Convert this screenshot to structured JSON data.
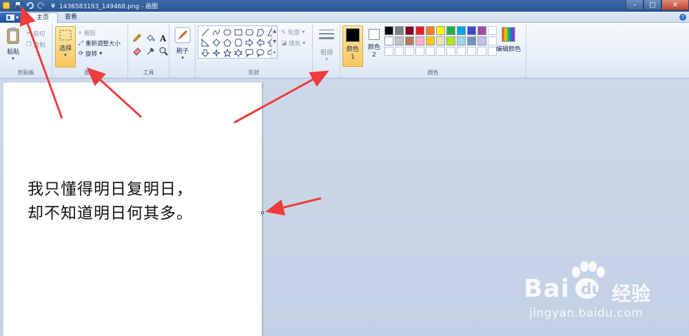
{
  "window": {
    "title": "1436583193_149468.png - 画图",
    "minimize": "–",
    "maximize": "□",
    "close": "✕"
  },
  "tabs": [
    {
      "label": "主页"
    },
    {
      "label": "查看"
    }
  ],
  "help": "?",
  "ribbon": {
    "clipboard": {
      "paste": "粘贴",
      "cut": "剪切",
      "copy": "复制",
      "group": "剪贴板"
    },
    "image": {
      "select": "选择",
      "crop": "裁剪",
      "resize": "重新调整大小",
      "rotate": "旋转",
      "group": "图像"
    },
    "tools": {
      "group": "工具"
    },
    "brushes": {
      "label": "刷子"
    },
    "shapes": {
      "outline": "轮廓",
      "fill": "填充",
      "group": "形状"
    },
    "size": {
      "label": "粗细"
    },
    "colors": {
      "color1": "颜色 1",
      "color2": "颜色 2",
      "edit": "编辑颜色",
      "group": "颜色",
      "color1_value": "#000000",
      "color2_value": "#ffffff",
      "palette_row1": [
        "#000000",
        "#7f7f7f",
        "#880015",
        "#ed1c24",
        "#ff7f27",
        "#fff200",
        "#22b14c",
        "#00a2e8",
        "#3f48cc",
        "#a349a4"
      ],
      "palette_row2": [
        "#ffffff",
        "#c3c3c3",
        "#b97a57",
        "#ffaec9",
        "#ffc90e",
        "#efe4b0",
        "#b5e61d",
        "#99d9ea",
        "#7092be",
        "#c8bfe7"
      ]
    }
  },
  "canvas": {
    "line1": "我只懂得明日复明日，",
    "line2": "却不知道明日何其多。"
  },
  "watermark": {
    "brand": "Bai",
    "cn": "经验",
    "url": "jingyan.baidu.com"
  },
  "colors": {
    "arrow": "#ee3b3b",
    "accent": "#f8c660"
  }
}
